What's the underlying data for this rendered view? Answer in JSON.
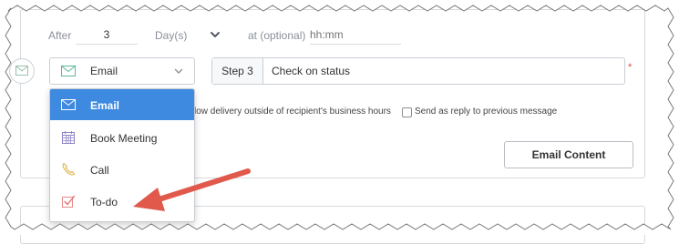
{
  "delay": {
    "after_label": "After",
    "amount": "3",
    "unit": "Day(s)",
    "at_label": "at (optional)",
    "time_placeholder": "hh:mm"
  },
  "step": {
    "type_selected": "Email",
    "prefix": "Step 3",
    "subject": "Check on status",
    "required_marker": "*"
  },
  "options": {
    "delivery_text": "low delivery outside of recipient's business hours",
    "reply_text": "Send as reply to previous message"
  },
  "actions": {
    "email_content_label": "Email Content"
  },
  "dropdown": {
    "items": [
      {
        "label": "Email",
        "icon": "envelope-icon",
        "selected": true
      },
      {
        "label": "Book Meeting",
        "icon": "calendar-icon",
        "selected": false
      },
      {
        "label": "Call",
        "icon": "phone-icon",
        "selected": false
      },
      {
        "label": "To-do",
        "icon": "checkbox-icon",
        "selected": false
      }
    ]
  },
  "colors": {
    "accent": "#3d8ae0",
    "annotation_arrow": "#e0594a",
    "required": "#e0463c"
  }
}
